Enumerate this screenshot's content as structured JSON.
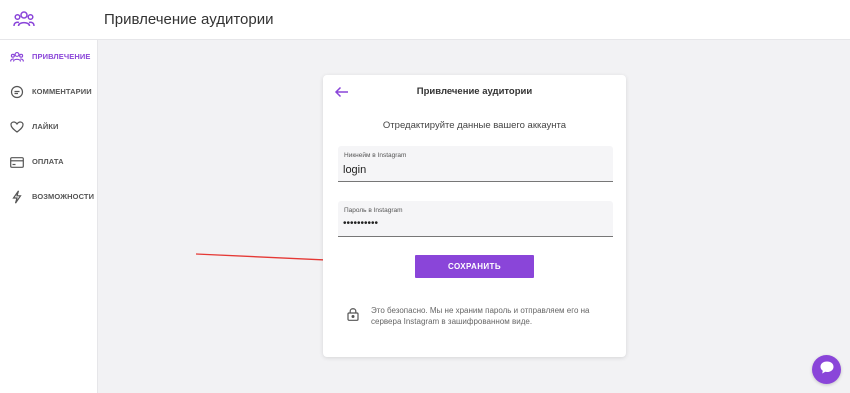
{
  "header": {
    "title": "Привлечение аудитории",
    "logo_icon": "people-group-icon"
  },
  "sidebar": {
    "items": [
      {
        "label": "ПРИВЛЕЧЕНИЕ",
        "icon": "people-group-icon",
        "active": true
      },
      {
        "label": "КОММЕНТАРИИ",
        "icon": "chat-bubble-icon",
        "active": false
      },
      {
        "label": "ЛАЙКИ",
        "icon": "heart-icon",
        "active": false
      },
      {
        "label": "ОПЛАТА",
        "icon": "credit-card-icon",
        "active": false
      },
      {
        "label": "ВОЗМОЖНОСТИ",
        "icon": "lightning-icon",
        "active": false
      }
    ]
  },
  "card": {
    "title": "Привлечение аудитории",
    "subtitle": "Отредактируйте данные вашего аккаунта",
    "username_field": {
      "label": "Никнейм в Instagram",
      "value": "login"
    },
    "password_field": {
      "label": "Пароль в Instagram",
      "value": "••••••••••"
    },
    "save_label": "СОХРАНИТЬ",
    "security_note": "Это безопасно. Мы не храним пароль и отправляем его на сервера Instagram в зашифрованном виде."
  },
  "colors": {
    "accent": "#8a45d9",
    "annotation_arrow": "#e53935",
    "background": "#f2f2f4"
  }
}
